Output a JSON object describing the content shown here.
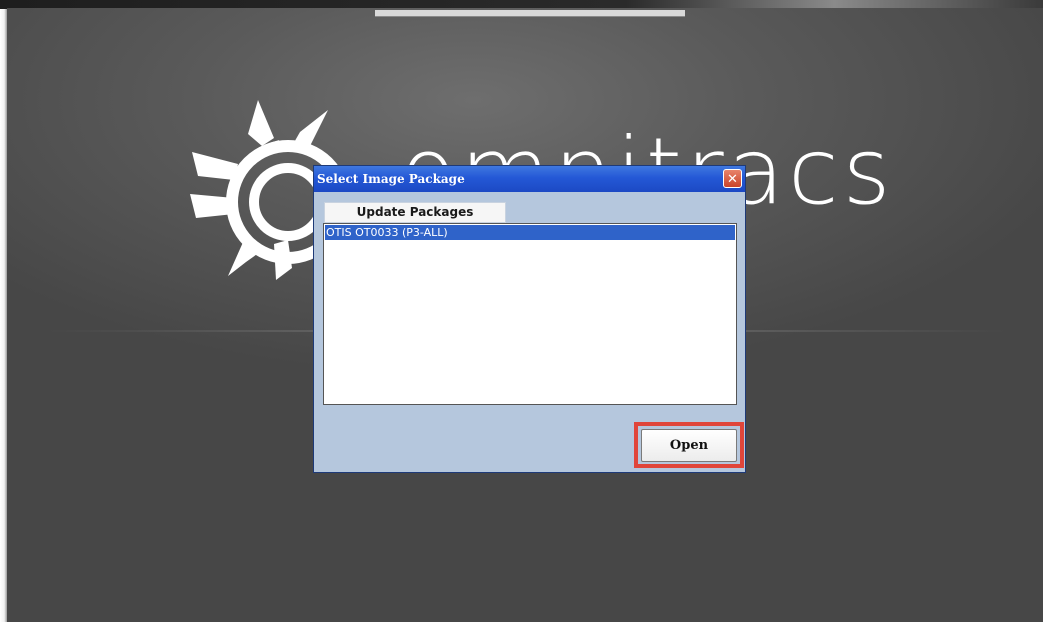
{
  "background": {
    "logo_text": "omnitracs",
    "logo_icon": "omnitracs-sunburst-logo-icon"
  },
  "dialog": {
    "title": "Select Image Package",
    "close_icon": "close-icon",
    "column_header": "Update Packages",
    "packages": [
      {
        "label": "OTIS OT0033 (P3-ALL)",
        "selected": true
      }
    ],
    "open_label": "Open"
  },
  "colors": {
    "titlebar": "#2458d6",
    "dialog_body": "#b5c7dd",
    "selection": "#2f63c9",
    "highlight_box": "#e0453a",
    "screen_background": "#5a5a5a"
  }
}
